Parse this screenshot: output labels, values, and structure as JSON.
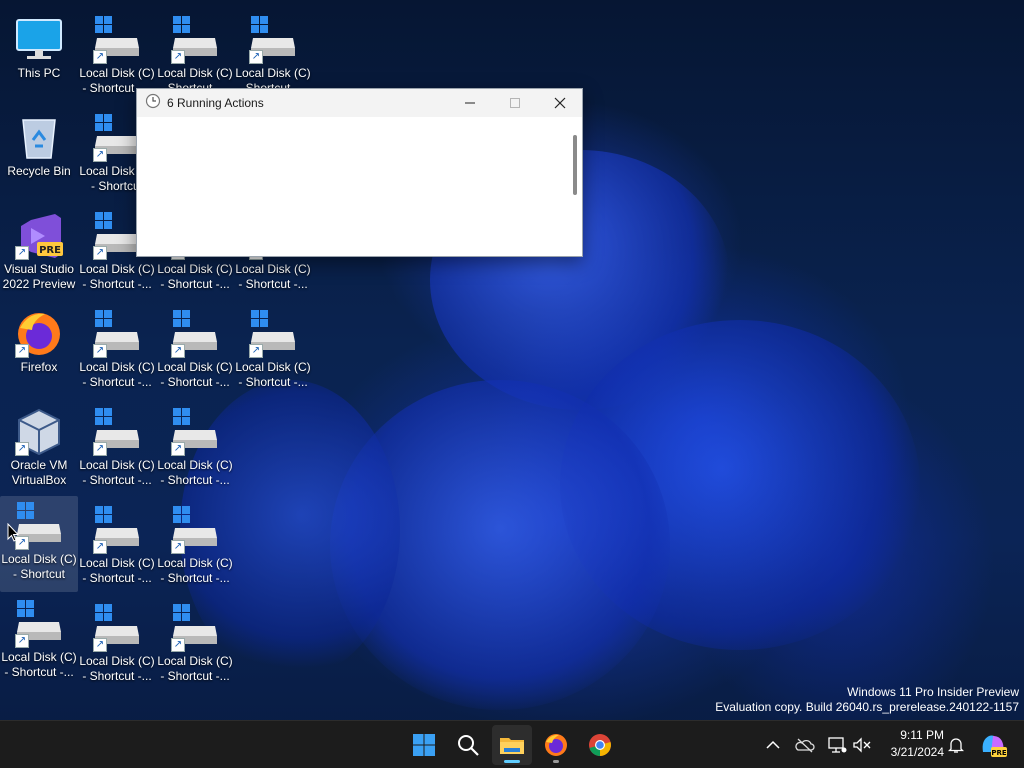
{
  "desktop": {
    "icons": [
      {
        "id": "this-pc",
        "label": "This PC",
        "type": "pc"
      },
      {
        "id": "recycle-bin",
        "label": "Recycle Bin",
        "type": "bin"
      },
      {
        "id": "vs2022",
        "label": "Visual Studio 2022 Preview",
        "type": "vs",
        "badge": "PRE"
      },
      {
        "id": "firefox",
        "label": "Firefox",
        "type": "firefox"
      },
      {
        "id": "virtualbox",
        "label": "Oracle VM VirtualBox",
        "type": "vbox"
      },
      {
        "id": "ld-c1-r6",
        "label": "Local Disk (C) - Shortcut",
        "type": "disk",
        "selected": true
      },
      {
        "id": "ld-c1-r7",
        "label": "Local Disk (C) - Shortcut -...",
        "type": "disk"
      },
      {
        "id": "ld-c2-r1",
        "label": "Local Disk (C) - Shortcut -...",
        "type": "disk"
      },
      {
        "id": "ld-c2-r2",
        "label": "Local Disk (C) - Shortcut",
        "type": "disk"
      },
      {
        "id": "ld-c2-r3",
        "label": "Local Disk (C) - Shortcut -...",
        "type": "disk"
      },
      {
        "id": "ld-c2-r4",
        "label": "Local Disk (C) - Shortcut -...",
        "type": "disk"
      },
      {
        "id": "ld-c2-r5",
        "label": "Local Disk (C) - Shortcut -...",
        "type": "disk"
      },
      {
        "id": "ld-c2-r6",
        "label": "Local Disk (C) - Shortcut -...",
        "type": "disk"
      },
      {
        "id": "ld-c2-r7",
        "label": "Local Disk (C) - Shortcut -...",
        "type": "disk"
      },
      {
        "id": "ld-c3-r1",
        "label": "Local Disk (C) - Shortcut -...",
        "type": "disk"
      },
      {
        "id": "ld-c3-r3",
        "label": "Local Disk (C) - Shortcut -...",
        "type": "disk"
      },
      {
        "id": "ld-c3-r4",
        "label": "Local Disk (C) - Shortcut -...",
        "type": "disk"
      },
      {
        "id": "ld-c3-r5",
        "label": "Local Disk (C) - Shortcut -...",
        "type": "disk"
      },
      {
        "id": "ld-c3-r6",
        "label": "Local Disk (C) - Shortcut -...",
        "type": "disk"
      },
      {
        "id": "ld-c3-r7",
        "label": "Local Disk (C) - Shortcut -...",
        "type": "disk"
      },
      {
        "id": "ld-c4-r1",
        "label": "Local Disk (C) - Shortcut -...",
        "type": "disk"
      },
      {
        "id": "ld-c4-r3",
        "label": "Local Disk (C) - Shortcut -...",
        "type": "disk"
      },
      {
        "id": "ld-c4-r4",
        "label": "Local Disk (C) - Shortcut -...",
        "type": "disk"
      }
    ]
  },
  "window": {
    "title": "6 Running Actions",
    "icon": "clock-icon"
  },
  "watermark": {
    "line1": "Windows 11 Pro Insider Preview",
    "line2": "Evaluation copy. Build 26040.rs_prerelease.240122-1157"
  },
  "taskbar": {
    "items": [
      "start-icon",
      "search-icon",
      "file-explorer-icon",
      "firefox-icon",
      "chrome-icon"
    ],
    "tray": [
      "chevron-up-icon",
      "onedrive-offline-icon",
      "network-icon",
      "volume-muted-icon",
      "notification-bell-icon",
      "copilot-icon"
    ],
    "time": "9:11 PM",
    "date": "3/21/2024",
    "copilot_badge": "PRE"
  },
  "colors": {
    "accent": "#60cdff",
    "taskbar_bg": "#1c1c1c",
    "wallpaper_dark": "#0a2350",
    "wallpaper_bloom": "#1f4df0"
  }
}
